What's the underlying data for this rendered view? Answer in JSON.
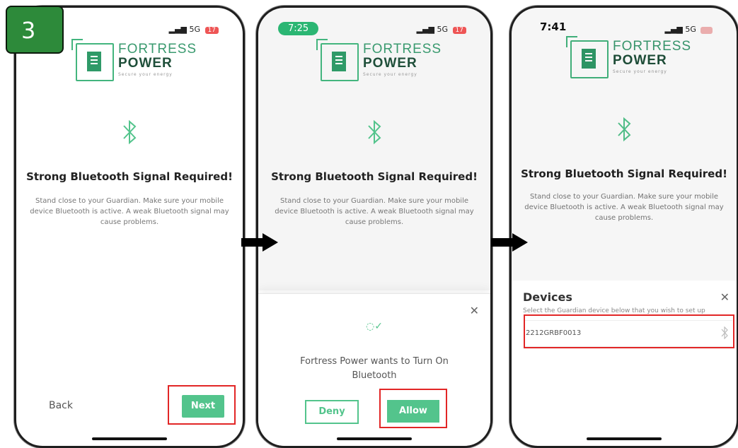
{
  "step_number": "3",
  "screens": [
    {
      "status": {
        "time": "",
        "signal": "5G",
        "battery": "17"
      },
      "logo": {
        "line1": "FORTRESS",
        "line2": "POWER",
        "tagline": "Secure your energy"
      },
      "heading": "Strong Bluetooth Signal Required!",
      "body": "Stand close to your Guardian. Make sure your mobile device Bluetooth is active. A weak Bluetooth signal may cause problems.",
      "back_label": "Back",
      "next_label": "Next"
    },
    {
      "status": {
        "time": "7:25",
        "signal": "5G",
        "battery": "17"
      },
      "logo": {
        "line1": "FORTRESS",
        "line2": "POWER",
        "tagline": "Secure your energy"
      },
      "heading": "Strong Bluetooth Signal Required!",
      "body": "Stand close to your Guardian. Make sure your mobile device Bluetooth is active. A weak Bluetooth signal may cause problems.",
      "dialog": {
        "message": "Fortress Power wants to Turn On Bluetooth",
        "deny_label": "Deny",
        "allow_label": "Allow"
      }
    },
    {
      "status": {
        "time": "7:41",
        "signal": "5G",
        "battery": ""
      },
      "logo": {
        "line1": "FORTRESS",
        "line2": "POWER",
        "tagline": "Secure your energy"
      },
      "heading": "Strong Bluetooth Signal Required!",
      "body": "Stand close to your Guardian. Make sure your mobile device Bluetooth is active. A weak Bluetooth signal may cause problems.",
      "devices": {
        "title": "Devices",
        "subtitle": "Select the Guardian device below that you wish to set up",
        "items": [
          "2212GRBF0013"
        ]
      }
    }
  ],
  "colors": {
    "brand_green": "#53c48c",
    "highlight_red": "#e22626",
    "step_badge": "#2d8a3a"
  },
  "icons": [
    "bluetooth-icon",
    "close-icon",
    "check-icon",
    "signal-icon",
    "battery-icon",
    "arrow-right-icon"
  ]
}
